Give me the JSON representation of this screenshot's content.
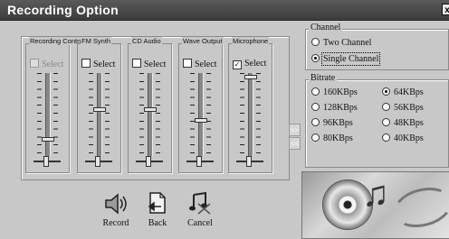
{
  "window": {
    "title": "Recording Option",
    "close_glyph": "x"
  },
  "mixer": {
    "strips": [
      {
        "label": "Recording Control",
        "check_label": "Select",
        "checked": false,
        "enabled": false,
        "level": 0.18
      },
      {
        "label": "FM Synth",
        "check_label": "Select",
        "checked": false,
        "enabled": true,
        "level": 0.56
      },
      {
        "label": "CD Audio",
        "check_label": "Select",
        "checked": false,
        "enabled": true,
        "level": 0.56
      },
      {
        "label": "Wave Output",
        "check_label": "Select",
        "checked": false,
        "enabled": true,
        "level": 0.43
      },
      {
        "label": "Microphone",
        "check_label": "Select",
        "checked": true,
        "enabled": true,
        "level": 0.98
      }
    ]
  },
  "channel": {
    "label": "Channel",
    "options": [
      {
        "label": "Two Channel",
        "selected": false
      },
      {
        "label": "Single Channel",
        "selected": true
      }
    ]
  },
  "bitrate": {
    "label": "Bitrate",
    "options": [
      {
        "label": "160KBps",
        "selected": false
      },
      {
        "label": "64KBps",
        "selected": true
      },
      {
        "label": "128KBps",
        "selected": false
      },
      {
        "label": "56KBps",
        "selected": false
      },
      {
        "label": "96KBps",
        "selected": false
      },
      {
        "label": "48KBps",
        "selected": false
      },
      {
        "label": "80KBps",
        "selected": false
      },
      {
        "label": "40KBps",
        "selected": false
      }
    ]
  },
  "arrows": {
    "expand": ">>",
    "collapse": "<<"
  },
  "actions": {
    "record": {
      "label": "Record",
      "icon": "speaker-icon"
    },
    "back": {
      "label": "Back",
      "icon": "document-back-icon"
    },
    "cancel": {
      "label": "Cancel",
      "icon": "music-note-cancel-icon"
    }
  }
}
